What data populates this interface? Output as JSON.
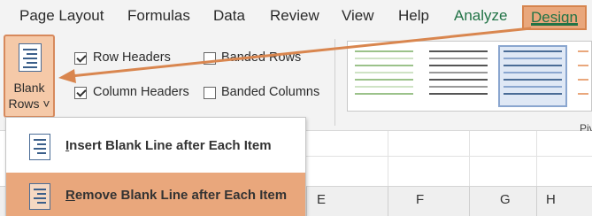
{
  "ribbon_tabs": [
    "Page Layout",
    "Formulas",
    "Data",
    "Review",
    "View",
    "Help",
    "Analyze",
    "Design"
  ],
  "layout_group": {
    "blank_rows_line1": "Blank",
    "blank_rows_line2": "Rows",
    "dropdown_glyph": "˅"
  },
  "style_options": {
    "row_headers": {
      "label": "Row Headers",
      "checked": true
    },
    "column_headers": {
      "label": "Column Headers",
      "checked": true
    },
    "banded_rows": {
      "label": "Banded Rows",
      "checked": false
    },
    "banded_columns": {
      "label": "Banded Columns",
      "checked": false
    }
  },
  "pivot_label_partial": "Piv",
  "sheet": {
    "column_headers": [
      "E",
      "F",
      "G",
      "H"
    ]
  },
  "blank_rows_menu": {
    "items": [
      {
        "underline": "I",
        "rest": "nsert Blank Line after Each Item"
      },
      {
        "underline": "R",
        "rest": "emove Blank Line after Each Item"
      }
    ]
  },
  "colors": {
    "highlight": "#e9a77c",
    "highlight_border": "#d6844e",
    "tab_accent": "#217346",
    "ribbon_bg": "#f3f3f3",
    "icon_blue": "#3b5f8a"
  },
  "icons": [
    "blank-rows-icon",
    "insert-blank-line-icon",
    "remove-blank-line-icon",
    "checkbox-checked",
    "checkbox-unchecked",
    "chevron-down-icon",
    "arrow-annotation"
  ]
}
